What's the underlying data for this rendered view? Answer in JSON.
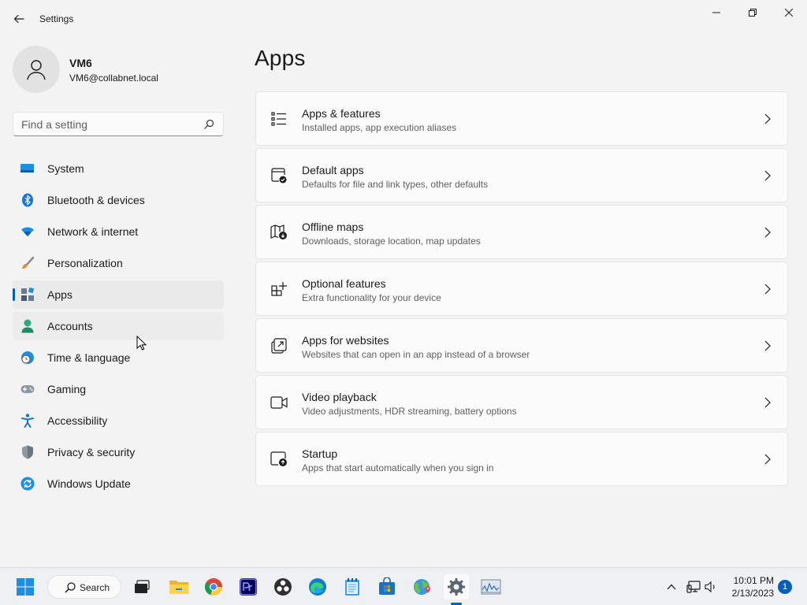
{
  "window": {
    "title": "Settings"
  },
  "profile": {
    "name": "VM6",
    "email": "VM6@collabnet.local"
  },
  "search": {
    "placeholder": "Find a setting"
  },
  "nav": {
    "items": [
      {
        "label": "System",
        "icon": "monitor-icon"
      },
      {
        "label": "Bluetooth & devices",
        "icon": "bluetooth-icon"
      },
      {
        "label": "Network & internet",
        "icon": "wifi-icon"
      },
      {
        "label": "Personalization",
        "icon": "brush-icon"
      },
      {
        "label": "Apps",
        "icon": "apps-icon",
        "selected": true
      },
      {
        "label": "Accounts",
        "icon": "person-icon",
        "hovered": true
      },
      {
        "label": "Time & language",
        "icon": "globe-clock-icon"
      },
      {
        "label": "Gaming",
        "icon": "gamepad-icon"
      },
      {
        "label": "Accessibility",
        "icon": "accessibility-icon"
      },
      {
        "label": "Privacy & security",
        "icon": "shield-icon"
      },
      {
        "label": "Windows Update",
        "icon": "update-icon"
      }
    ]
  },
  "main": {
    "title": "Apps",
    "cards": [
      {
        "title": "Apps & features",
        "desc": "Installed apps, app execution aliases",
        "icon": "list-icon"
      },
      {
        "title": "Default apps",
        "desc": "Defaults for file and link types, other defaults",
        "icon": "default-apps-icon"
      },
      {
        "title": "Offline maps",
        "desc": "Downloads, storage location, map updates",
        "icon": "map-download-icon"
      },
      {
        "title": "Optional features",
        "desc": "Extra functionality for your device",
        "icon": "grid-add-icon"
      },
      {
        "title": "Apps for websites",
        "desc": "Websites that can open in an app instead of a browser",
        "icon": "open-external-icon"
      },
      {
        "title": "Video playback",
        "desc": "Video adjustments, HDR streaming, battery options",
        "icon": "video-icon"
      },
      {
        "title": "Startup",
        "desc": "Apps that start automatically when you sign in",
        "icon": "startup-icon"
      }
    ]
  },
  "taskbar": {
    "search_label": "Search",
    "apps": [
      "start-icon",
      "task-view-icon",
      "file-explorer-icon",
      "chrome-icon",
      "premiere-icon",
      "obs-icon",
      "edge-icon",
      "notepad-icon",
      "store-icon",
      "maps-globe-icon",
      "settings-gear-icon",
      "resource-monitor-icon"
    ],
    "active_app": "settings-gear-icon",
    "time": "10:01 PM",
    "date": "2/13/2023",
    "notification_count": "1"
  },
  "colors": {
    "accent": "#005fb8",
    "background": "#f3f3f3",
    "card": "#fbfbfb"
  }
}
